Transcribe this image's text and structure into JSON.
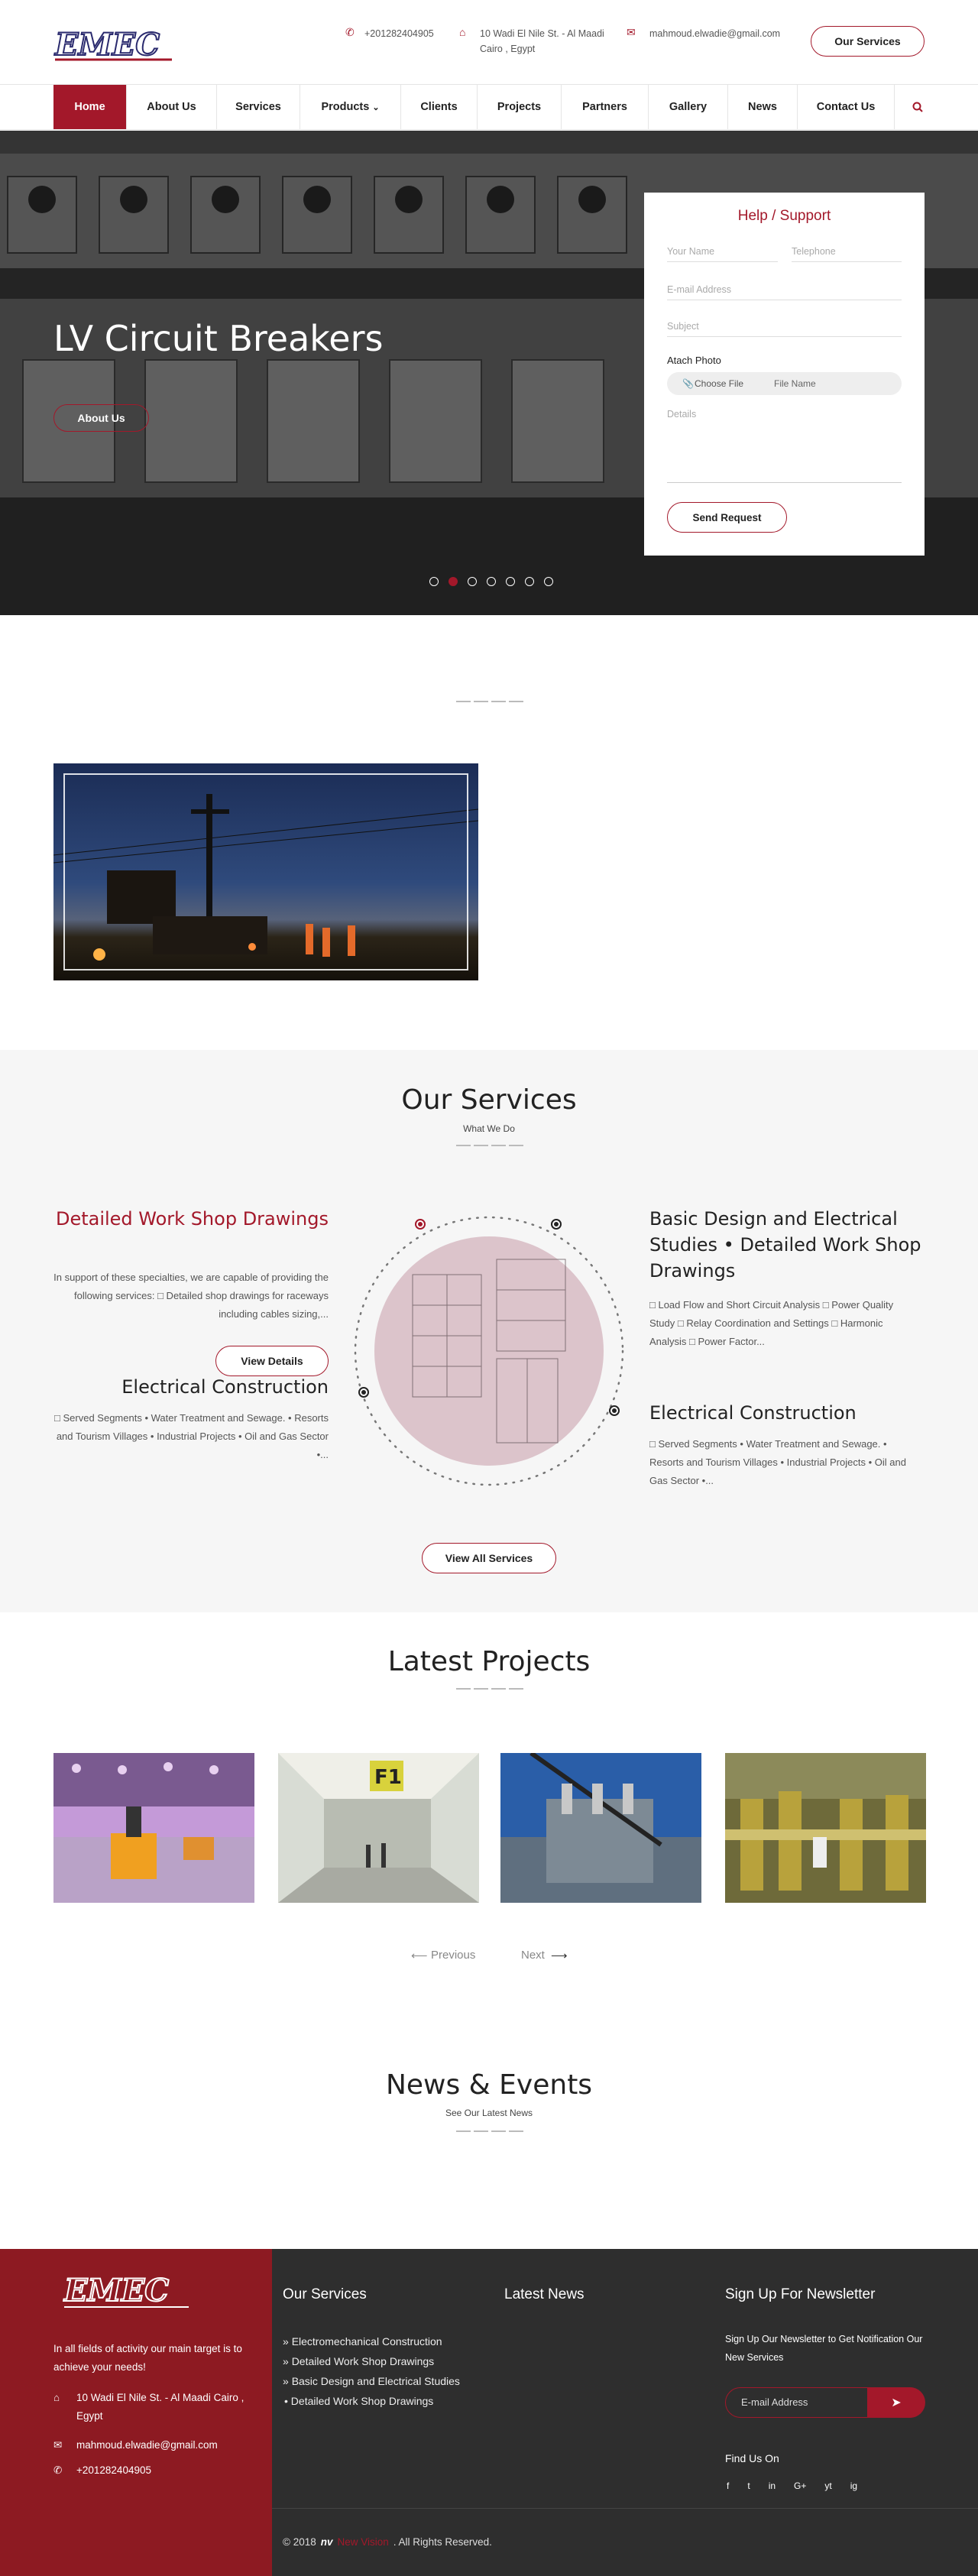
{
  "header": {
    "phone": "+201282404905",
    "address_line1": "10 Wadi El Nile St. - Al Maadi",
    "address_line2": "Cairo , Egypt",
    "email": "mahmoud.elwadie@gmail.com",
    "cta_label": "Our Services",
    "brand": "EMEC"
  },
  "nav": {
    "items": [
      "Home",
      "About Us",
      "Services",
      "Products",
      "Clients",
      "Projects",
      "Partners",
      "Gallery",
      "News",
      "Contact Us"
    ],
    "products_caret": "⌄"
  },
  "hero": {
    "title": "LV Circuit Breakers",
    "button_label": "About Us",
    "active_slide": 2
  },
  "support_form": {
    "title": "Help / Support",
    "name_placeholder": "Your Name",
    "phone_placeholder": "Telephone",
    "email_placeholder": "E-mail Address",
    "subject_placeholder": "Subject",
    "photo_label": "Atach Photo",
    "choose_file": "Choose File",
    "file_name": "File Name",
    "details_placeholder": "Details",
    "submit_label": "Send Request"
  },
  "services": {
    "title": "Our Services",
    "subtitle": "What We Do",
    "left": [
      {
        "title": "Detailed Work Shop Drawings",
        "text": "In support of these specialties, we are capable of providing the following services: □ Detailed shop drawings for raceways including cables sizing,...",
        "button": "View Details"
      },
      {
        "title": "Electrical Construction",
        "text": "□ Served Segments • Water Treatment and Sewage. • Resorts and Tourism Villages • Industrial Projects • Oil and Gas Sector •..."
      }
    ],
    "right": [
      {
        "title": "Basic Design and Electrical Studies • Detailed Work Shop Drawings",
        "text": "□ Load Flow and Short Circuit Analysis □ Power Quality Study □ Relay Coordination and Settings □ Harmonic Analysis □ Power Factor..."
      },
      {
        "title": "Electrical Construction",
        "text": "□ Served Segments • Water Treatment and Sewage. • Resorts and Tourism Villages • Industrial Projects • Oil and Gas Sector •..."
      }
    ],
    "view_all": "View All Services"
  },
  "projects": {
    "title": "Latest Projects",
    "previous": "Previous",
    "next": "Next",
    "sign_f1": "F1"
  },
  "news": {
    "title": "News & Events",
    "subtitle": "See Our Latest News"
  },
  "footer": {
    "brand": "EMEC",
    "tagline": "In all fields of activity our main target is to achieve your needs!",
    "address": "10 Wadi El Nile St. - Al Maadi Cairo , Egypt",
    "email": "mahmoud.elwadie@gmail.com",
    "phone": "+201282404905",
    "services_head": "Our Services",
    "services_links": [
      "Electromechanical Construction",
      "Detailed Work Shop Drawings",
      "Basic Design and Electrical Studies",
      "• Detailed Work Shop Drawings"
    ],
    "news_head": "Latest News",
    "newsletter_head": "Sign Up For Newsletter",
    "newsletter_text": "Sign Up Our Newsletter to Get Notification Our New Services",
    "email_placeholder": "E-mail Address",
    "find_us": "Find Us On",
    "social": [
      "f",
      "t",
      "in",
      "G+",
      "yt",
      "ig"
    ],
    "copyright_prefix": "© 2018",
    "copyright_brand": "New Vision",
    "copyright_suffix": ". All Rights Reserved."
  },
  "colors": {
    "accent": "#a3182a",
    "footer_dark": "#2e2e2e",
    "footer_red": "#8d1a22"
  }
}
